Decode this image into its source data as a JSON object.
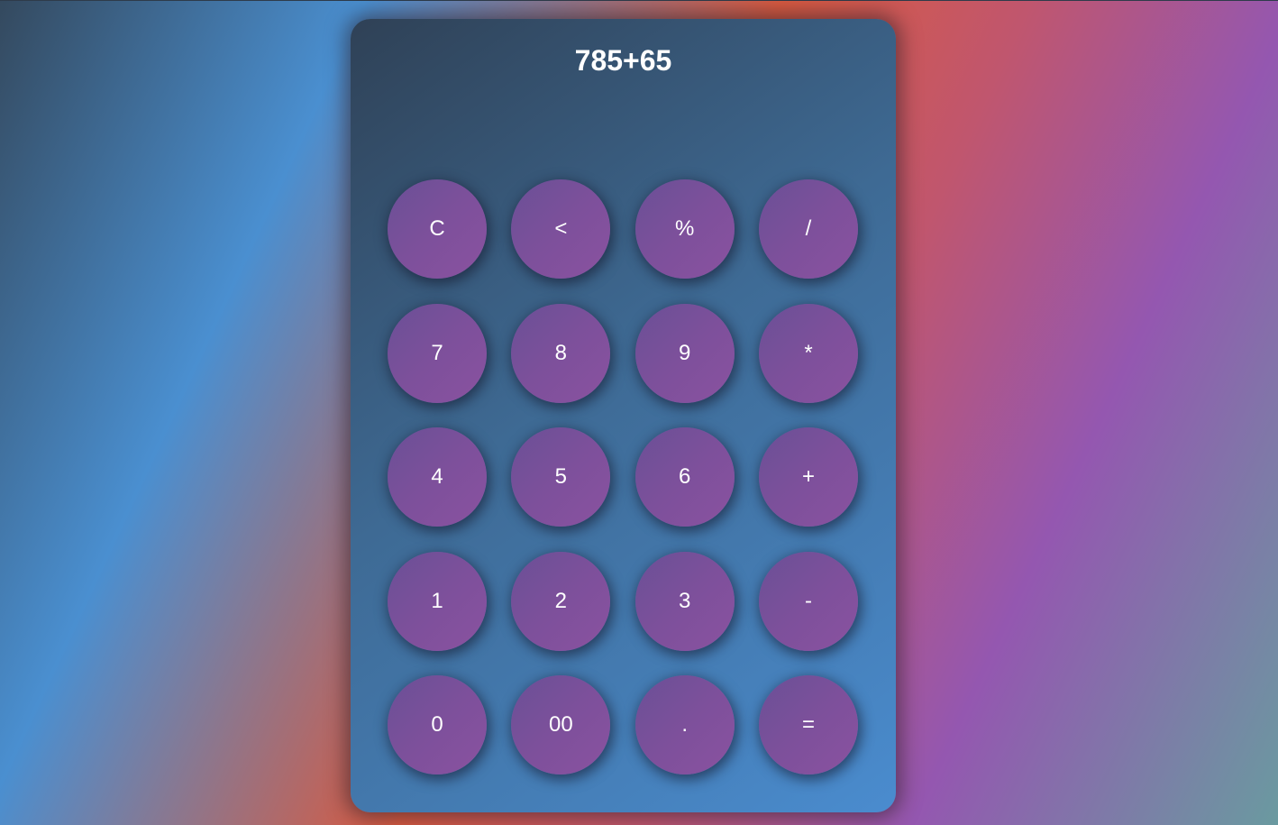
{
  "calculator": {
    "display_value": "785+65",
    "keys": [
      "C",
      "<",
      "%",
      "/",
      "7",
      "8",
      "9",
      "*",
      "4",
      "5",
      "6",
      "+",
      "1",
      "2",
      "3",
      "-",
      "0",
      "00",
      ".",
      "="
    ]
  },
  "colors": {
    "key_purple": "#7d509b",
    "panel_dark": "#2f4156",
    "panel_light": "#4a8ccf",
    "text": "#ffffff"
  }
}
